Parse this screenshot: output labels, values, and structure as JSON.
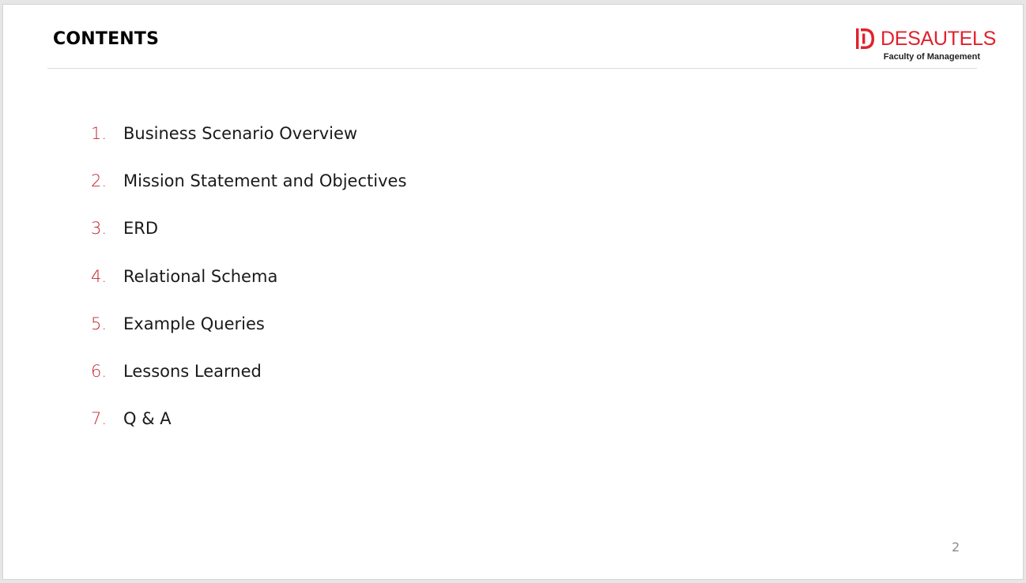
{
  "slide": {
    "title": "CONTENTS",
    "page_number": "2",
    "logo": {
      "wordmark": "DESAUTELS",
      "subtitle": "Faculty of Management",
      "icon": "desautels-logo-icon",
      "color": "#e2202c"
    },
    "accent_color": "#c0262f",
    "items": [
      {
        "number": "1.",
        "label": "Business Scenario Overview"
      },
      {
        "number": "2.",
        "label": "Mission Statement and Objectives"
      },
      {
        "number": "3.",
        "label": "ERD"
      },
      {
        "number": "4.",
        "label": "Relational Schema"
      },
      {
        "number": "5.",
        "label": "Example Queries"
      },
      {
        "number": "6.",
        "label": "Lessons Learned"
      },
      {
        "number": "7.",
        "label": "Q & A"
      }
    ]
  }
}
